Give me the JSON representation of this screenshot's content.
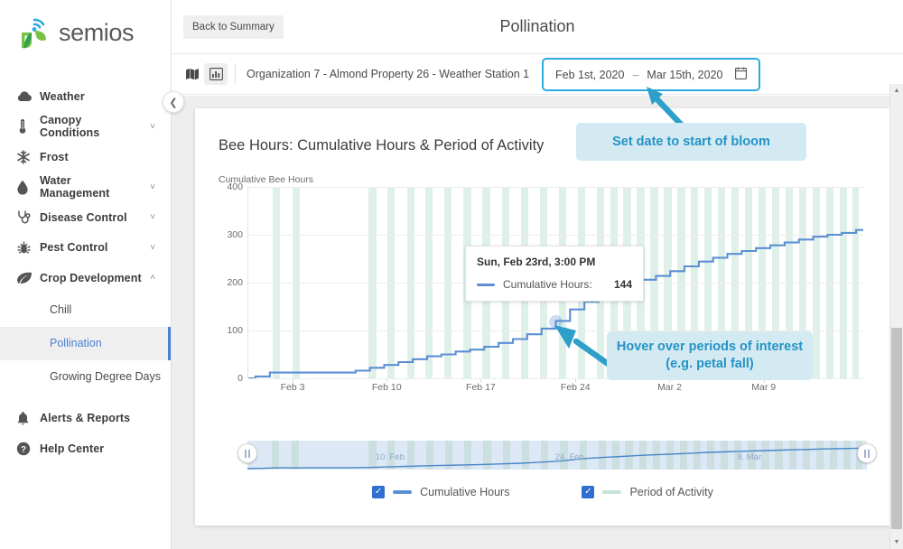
{
  "brand": {
    "name": "semios",
    "accent": "#7ac143",
    "accent2": "#29abe2"
  },
  "sidebar": {
    "collapse_icon": "chevron-left-icon",
    "items": [
      {
        "label": "Weather",
        "icon": "cloud-icon",
        "chevron": ""
      },
      {
        "label": "Canopy Conditions",
        "icon": "thermometer-icon",
        "chevron": "˅"
      },
      {
        "label": "Frost",
        "icon": "snowflake-icon",
        "chevron": ""
      },
      {
        "label": "Water Management",
        "icon": "water-drop-icon",
        "chevron": "˅"
      },
      {
        "label": "Disease Control",
        "icon": "stethoscope-icon",
        "chevron": "˅"
      },
      {
        "label": "Pest Control",
        "icon": "bug-icon",
        "chevron": "˅"
      },
      {
        "label": "Crop Development",
        "icon": "leaf-icon",
        "chevron": "˄"
      }
    ],
    "sub_items": [
      {
        "label": "Chill",
        "active": false
      },
      {
        "label": "Pollination",
        "active": true
      },
      {
        "label": "Growing Degree Days",
        "active": false
      }
    ],
    "footer_items": [
      {
        "label": "Alerts & Reports",
        "icon": "bell-icon"
      },
      {
        "label": "Help Center",
        "icon": "question-circle-icon"
      }
    ]
  },
  "topbar": {
    "back_label": "Back to Summary",
    "page_title": "Pollination"
  },
  "subbar": {
    "map_icon": "map-icon",
    "chart_icon": "bar-chart-icon",
    "breadcrumb": "Organization 7 - Almond Property 26 - Weather Station 1",
    "date_start": "Feb 1st, 2020",
    "date_separator": "–",
    "date_end": "Mar 15th, 2020",
    "calendar_icon": "calendar-icon",
    "date_highlight_color": "#29aae1"
  },
  "card": {
    "chart_title": "Bee Hours: Cumulative Hours & Period of Activity"
  },
  "tooltip": {
    "title": "Sun, Feb 23rd, 3:00 PM",
    "series_label": "Cumulative Hours:",
    "value": "144",
    "swatch_color": "#5b8fd4"
  },
  "annotations": [
    {
      "id": "set-date-callout",
      "text": "Set date to start of bloom"
    },
    {
      "id": "hover-callout",
      "text": "Hover over periods of interest (e.g. petal fall)"
    }
  ],
  "legend": [
    {
      "label": "Cumulative Hours",
      "color": "#5b8fd4",
      "checked": true
    },
    {
      "label": "Period of Activity",
      "color": "#c3e4d9",
      "checked": true
    }
  ],
  "navigator": {
    "labels": [
      "10. Feb",
      "24. Feb",
      "9. Mar"
    ],
    "handle_icon": "pause-grip-icon"
  },
  "scrollbar": {
    "up_icon": "scroll-up-arrow",
    "down_icon": "scroll-down-arrow"
  },
  "chart_data": {
    "type": "line",
    "title": "Bee Hours: Cumulative Hours & Period of Activity",
    "xlabel": "",
    "ylabel": "Cumulative Bee Hours",
    "ylim": [
      0,
      400
    ],
    "yticks": [
      0,
      100,
      200,
      300,
      400
    ],
    "xticks": [
      "Feb 3",
      "Feb 10",
      "Feb 17",
      "Feb 24",
      "Mar 2",
      "Mar 9"
    ],
    "xtick_positions_pct": [
      7.2,
      22.5,
      37.8,
      53.2,
      68.5,
      83.8
    ],
    "grid": true,
    "legend_position": "bottom",
    "series": [
      {
        "name": "Cumulative Hours",
        "color": "#5b8fd4",
        "x": [
          "Feb 1",
          "Feb 2",
          "Feb 3",
          "Feb 4",
          "Feb 5",
          "Feb 6",
          "Feb 7",
          "Feb 8",
          "Feb 9",
          "Feb 10",
          "Feb 11",
          "Feb 12",
          "Feb 13",
          "Feb 14",
          "Feb 15",
          "Feb 16",
          "Feb 17",
          "Feb 18",
          "Feb 19",
          "Feb 20",
          "Feb 21",
          "Feb 22",
          "Feb 23",
          "Feb 24",
          "Feb 25",
          "Feb 26",
          "Feb 27",
          "Feb 28",
          "Feb 29",
          "Mar 1",
          "Mar 2",
          "Mar 3",
          "Mar 4",
          "Mar 5",
          "Mar 6",
          "Mar 7",
          "Mar 8",
          "Mar 9",
          "Mar 10",
          "Mar 11",
          "Mar 12",
          "Mar 13",
          "Mar 14",
          "Mar 15"
        ],
        "values": [
          0,
          4,
          12,
          12,
          12,
          12,
          12,
          12,
          16,
          22,
          28,
          34,
          40,
          46,
          50,
          56,
          60,
          66,
          74,
          82,
          92,
          104,
          120,
          144,
          160,
          172,
          184,
          196,
          206,
          214,
          224,
          234,
          244,
          252,
          260,
          266,
          272,
          278,
          284,
          290,
          296,
          300,
          304,
          310
        ]
      },
      {
        "name": "Period of Activity",
        "color": "#c3e4d9",
        "type": "band",
        "bands_pct": [
          [
            4.0,
            1.1
          ],
          [
            7.2,
            1.1
          ],
          [
            19.6,
            1.2
          ],
          [
            22.6,
            1.2
          ],
          [
            25.8,
            1.2
          ],
          [
            28.8,
            1.2
          ],
          [
            31.9,
            1.2
          ],
          [
            35.0,
            1.2
          ],
          [
            38.1,
            1.2
          ],
          [
            41.2,
            1.2
          ],
          [
            44.3,
            1.2
          ],
          [
            47.4,
            1.2
          ],
          [
            50.5,
            1.2
          ],
          [
            53.6,
            1.2
          ],
          [
            56.7,
            1.2
          ],
          [
            58.9,
            1.2
          ],
          [
            61.0,
            1.2
          ],
          [
            63.2,
            1.2
          ],
          [
            65.4,
            1.2
          ],
          [
            67.6,
            1.2
          ],
          [
            69.8,
            1.2
          ],
          [
            72.0,
            1.2
          ],
          [
            74.2,
            1.2
          ],
          [
            76.4,
            1.2
          ],
          [
            78.6,
            1.2
          ],
          [
            80.8,
            1.2
          ],
          [
            83.0,
            1.2
          ],
          [
            85.2,
            1.2
          ],
          [
            87.4,
            1.2
          ],
          [
            89.6,
            1.2
          ],
          [
            91.8,
            1.2
          ],
          [
            94.0,
            1.2
          ],
          [
            96.2,
            1.2
          ],
          [
            98.3,
            1.0
          ]
        ]
      }
    ]
  }
}
